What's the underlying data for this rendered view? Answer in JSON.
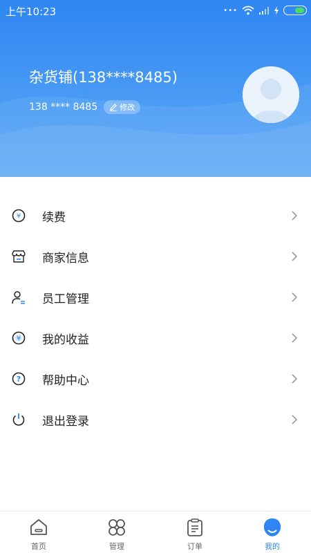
{
  "status_bar": {
    "time": "上午10:23",
    "dots": "•••"
  },
  "profile": {
    "shop_name": "杂货铺(138****8485)",
    "phone": "138 **** 8485",
    "edit_label": "修改"
  },
  "menu": [
    {
      "label": "续费",
      "icon": "yen-coin-icon"
    },
    {
      "label": "商家信息",
      "icon": "store-icon"
    },
    {
      "label": "员工管理",
      "icon": "staff-icon"
    },
    {
      "label": "我的收益",
      "icon": "earnings-icon"
    },
    {
      "label": "帮助中心",
      "icon": "help-icon"
    },
    {
      "label": "退出登录",
      "icon": "power-icon"
    }
  ],
  "tabs": [
    {
      "label": "首页",
      "icon": "home-icon"
    },
    {
      "label": "管理",
      "icon": "grid-clover-icon"
    },
    {
      "label": "订单",
      "icon": "clipboard-icon"
    },
    {
      "label": "我的",
      "icon": "profile-face-icon",
      "active": true
    }
  ],
  "colors": {
    "primary": "#2f86f2",
    "battery": "#4cd964",
    "text": "#222222",
    "tab_inactive": "#666666"
  }
}
